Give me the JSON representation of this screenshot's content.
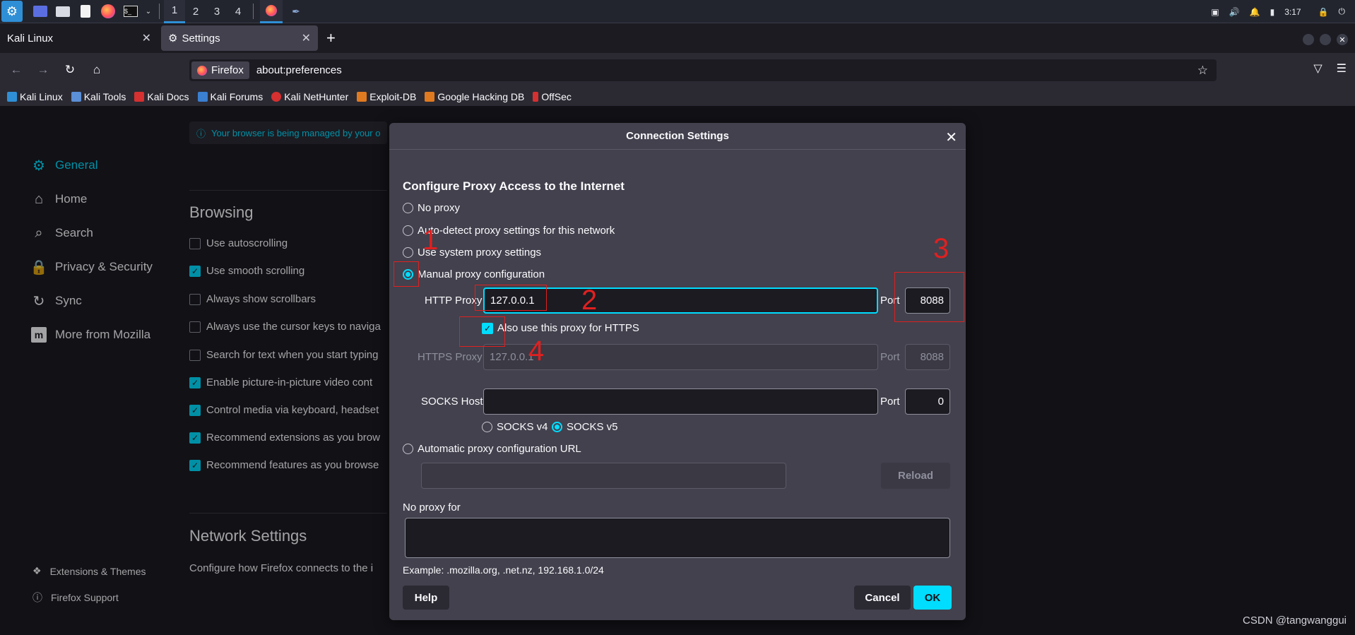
{
  "taskbar": {
    "workspaces": [
      "1",
      "2",
      "3",
      "4"
    ],
    "active_workspace": "1",
    "clock": "3:17",
    "accent": "#2f8fd6"
  },
  "browser": {
    "tabs": [
      {
        "label": "Kali Linux",
        "active": false
      },
      {
        "label": "Settings",
        "active": true
      }
    ],
    "identity_label": "Firefox",
    "url": "about:preferences",
    "bookmarks": [
      "Kali Linux",
      "Kali Tools",
      "Kali Docs",
      "Kali Forums",
      "Kali NetHunter",
      "Exploit-DB",
      "Google Hacking DB",
      "OffSec"
    ]
  },
  "settings": {
    "managed_notice": "Your browser is being managed by your o",
    "nav": [
      {
        "label": "General",
        "icon": "gear-icon",
        "active": true
      },
      {
        "label": "Home",
        "icon": "home-icon",
        "active": false
      },
      {
        "label": "Search",
        "icon": "search-icon",
        "active": false
      },
      {
        "label": "Privacy & Security",
        "icon": "lock-icon",
        "active": false
      },
      {
        "label": "Sync",
        "icon": "sync-icon",
        "active": false
      },
      {
        "label": "More from Mozilla",
        "icon": "mozilla-icon",
        "active": false
      }
    ],
    "footer": {
      "extensions": "Extensions & Themes",
      "support": "Firefox Support"
    },
    "browsing_title": "Browsing",
    "browsing_items": [
      {
        "label": "Use autoscrolling",
        "checked": false
      },
      {
        "label": "Use smooth scrolling",
        "checked": true
      },
      {
        "label": "Always show scrollbars",
        "checked": false
      },
      {
        "label": "Always use the cursor keys to naviga",
        "checked": false
      },
      {
        "label": "Search for text when you start typing",
        "checked": false
      },
      {
        "label": "Enable picture-in-picture video cont",
        "checked": true
      },
      {
        "label": "Control media via keyboard, headset",
        "checked": true
      },
      {
        "label": "Recommend extensions as you brow",
        "checked": true
      },
      {
        "label": "Recommend features as you browse",
        "checked": true
      }
    ],
    "network_title": "Network Settings",
    "network_desc": "Configure how Firefox connects to the i"
  },
  "dialog": {
    "title": "Connection Settings",
    "heading": "Configure Proxy Access to the Internet",
    "options": {
      "no_proxy": "No proxy",
      "auto_detect": "Auto-detect proxy settings for this network",
      "system": "Use system proxy settings",
      "manual": "Manual proxy configuration",
      "auto_url": "Automatic proxy configuration URL"
    },
    "selected_option": "manual",
    "http_proxy_label": "HTTP Proxy",
    "http_proxy_value": "127.0.0.1",
    "port_label": "Port",
    "http_port_value": "8088",
    "also_https_label": "Also use this proxy for HTTPS",
    "also_https_checked": true,
    "https_proxy_label": "HTTPS Proxy",
    "https_proxy_value": "127.0.0.1",
    "https_port_value": "8088",
    "socks_host_label": "SOCKS Host",
    "socks_host_value": "",
    "socks_port_value": "0",
    "socks_v4_label": "SOCKS v4",
    "socks_v5_label": "SOCKS v5",
    "socks_version_selected": "v5",
    "auto_url_value": "",
    "reload_label": "Reload",
    "no_proxy_for_label": "No proxy for",
    "no_proxy_for_value": "",
    "example_text": "Example: .mozilla.org, .net.nz, 192.168.1.0/24",
    "help_label": "Help",
    "cancel_label": "Cancel",
    "ok_label": "OK"
  },
  "annotations": {
    "numbers": [
      "1",
      "2",
      "3",
      "4"
    ],
    "color": "#e02020"
  },
  "watermark": "CSDN @tangwanggui",
  "colors": {
    "accent": "#00ddff",
    "dialog_bg": "#42414d",
    "page_bg": "#1c1b22"
  }
}
